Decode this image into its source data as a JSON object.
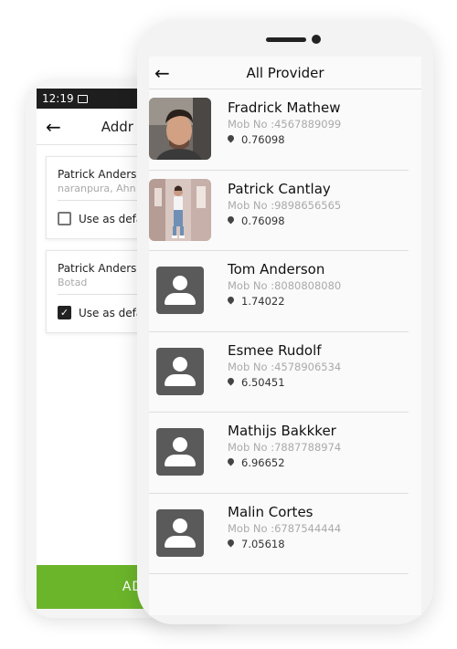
{
  "back_screen": {
    "status_time": "12:19",
    "header_title": "Addr",
    "addresses": [
      {
        "name": "Patrick  Anders",
        "address": "naranpura,  Ahn",
        "default_label": "Use as defau",
        "checked": false
      },
      {
        "name": "Patrick  Anders",
        "address": "Botad",
        "default_label": "Use as defau",
        "checked": true
      }
    ],
    "add_button_label": "AD",
    "accent_color": "#6bb52a"
  },
  "front_screen": {
    "header_title": "All Provider",
    "providers": [
      {
        "name": "Fradrick Mathew",
        "mob": "Mob No :4567889099",
        "distance": "0.76098",
        "avatar": "photo-man"
      },
      {
        "name": "Patrick Cantlay",
        "mob": "Mob No :9898656565",
        "distance": "0.76098",
        "avatar": "photo-woman"
      },
      {
        "name": "Tom Anderson",
        "mob": "Mob No :8080808080",
        "distance": "1.74022",
        "avatar": "placeholder"
      },
      {
        "name": "Esmee Rudolf",
        "mob": "Mob No :4578906534",
        "distance": "6.50451",
        "avatar": "placeholder"
      },
      {
        "name": "Mathijs Bakkker",
        "mob": "Mob No :7887788974",
        "distance": "6.96652",
        "avatar": "placeholder"
      },
      {
        "name": "Malin Cortes",
        "mob": "Mob No :6787544444",
        "distance": "7.05618",
        "avatar": "placeholder"
      }
    ]
  }
}
